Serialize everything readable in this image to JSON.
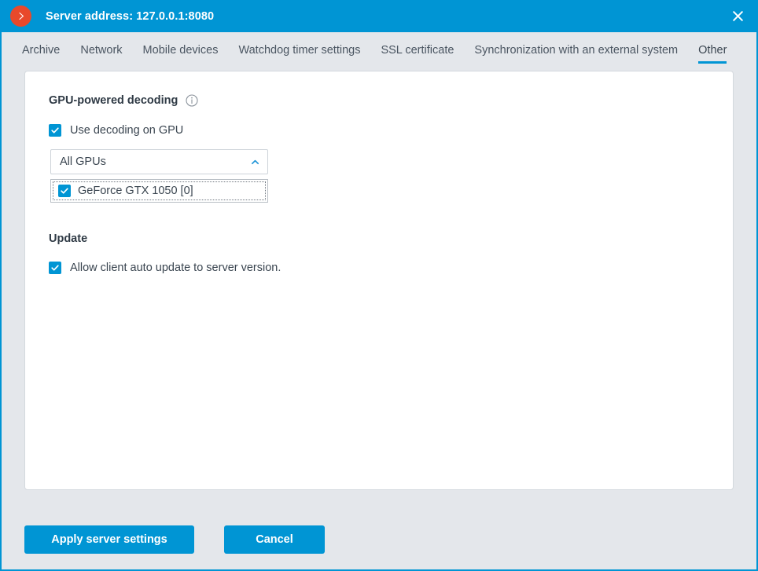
{
  "window": {
    "title": "Server address: 127.0.0.1:8080",
    "logo_icon": "chevron-right-circle-icon",
    "close_icon": "close-icon",
    "accent_color": "#0095d4",
    "logo_color": "#e8492b",
    "background_color": "#e4e7eb"
  },
  "tabs": [
    {
      "label": "Archive",
      "active": false
    },
    {
      "label": "Network",
      "active": false
    },
    {
      "label": "Mobile devices",
      "active": false
    },
    {
      "label": "Watchdog timer settings",
      "active": false
    },
    {
      "label": "SSL certificate",
      "active": false
    },
    {
      "label": "Synchronization with an external system",
      "active": false
    },
    {
      "label": "Other",
      "active": true
    }
  ],
  "gpu_section": {
    "title": "GPU-powered decoding",
    "info_icon": "info-icon",
    "use_gpu": {
      "label": "Use decoding on GPU",
      "checked": true,
      "icon": "checkmark-icon"
    },
    "combo": {
      "value": "All GPUs",
      "expanded": true,
      "chevron_icon": "chevron-up-icon"
    },
    "options": [
      {
        "label": "GeForce GTX 1050 [0]",
        "checked": true,
        "icon": "checkmark-icon",
        "focused": true
      }
    ]
  },
  "update_section": {
    "title": "Update",
    "auto_update": {
      "label": "Allow client auto update to server version.",
      "checked": true,
      "icon": "checkmark-icon"
    }
  },
  "footer": {
    "apply_label": "Apply server settings",
    "cancel_label": "Cancel"
  }
}
